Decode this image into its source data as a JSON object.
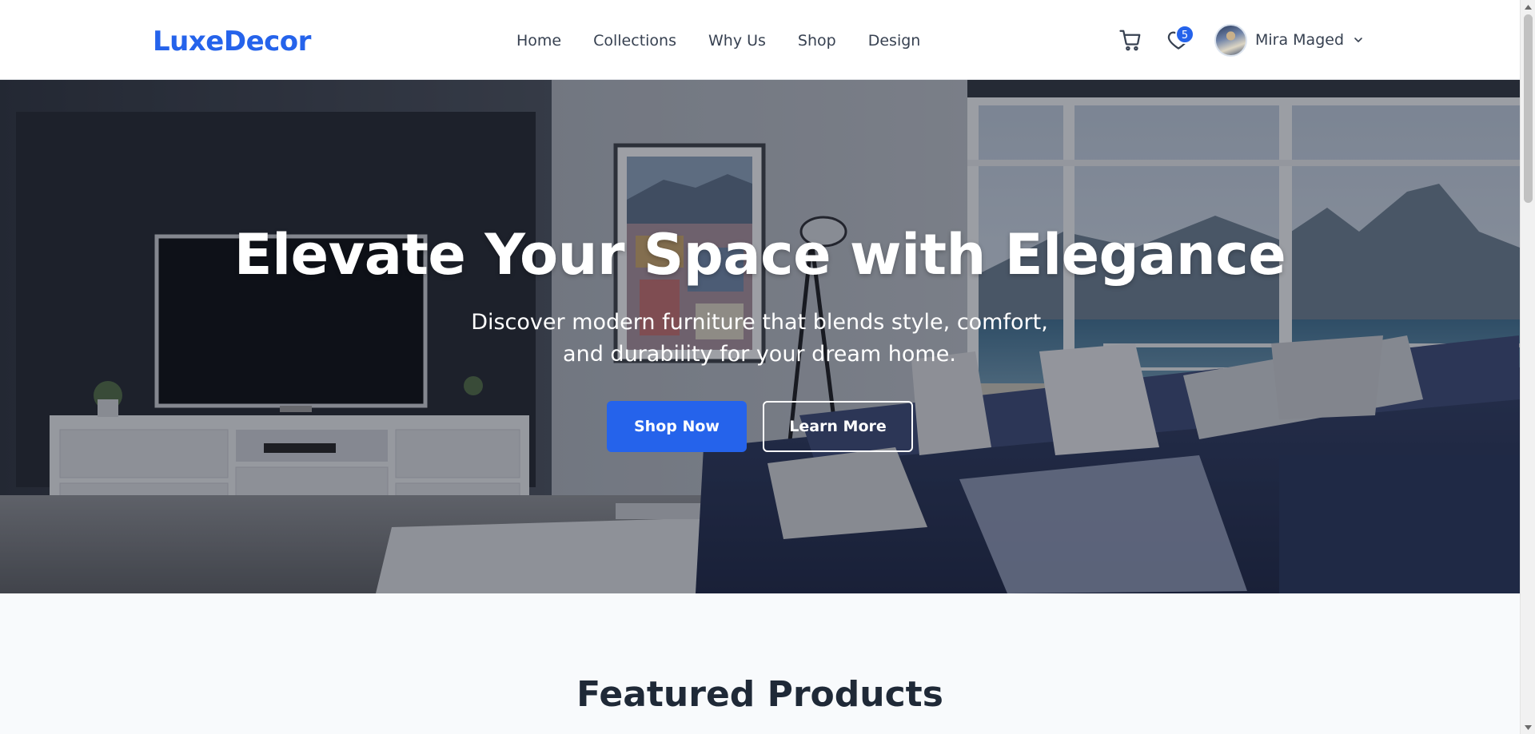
{
  "brand": {
    "name": "LuxeDecor",
    "color": "#2563eb"
  },
  "nav": {
    "items": [
      {
        "label": "Home"
      },
      {
        "label": "Collections"
      },
      {
        "label": "Why Us"
      },
      {
        "label": "Shop"
      },
      {
        "label": "Design"
      }
    ]
  },
  "header_actions": {
    "cart_icon": "cart-icon",
    "wishlist_icon": "heart-icon",
    "wishlist_count": "5",
    "user": {
      "name": "Mira Maged",
      "menu_icon": "chevron-down-icon"
    }
  },
  "hero": {
    "title": "Elevate Your Space with Elegance",
    "subtitle": "Discover modern furniture that blends style, comfort, and durability for your dream home.",
    "primary_button": "Shop Now",
    "secondary_button": "Learn More"
  },
  "featured": {
    "title": "Featured Products"
  },
  "colors": {
    "accent": "#2563eb",
    "text_dark": "#1f2937",
    "nav_text": "#374151",
    "page_bg": "#f8fafc"
  }
}
